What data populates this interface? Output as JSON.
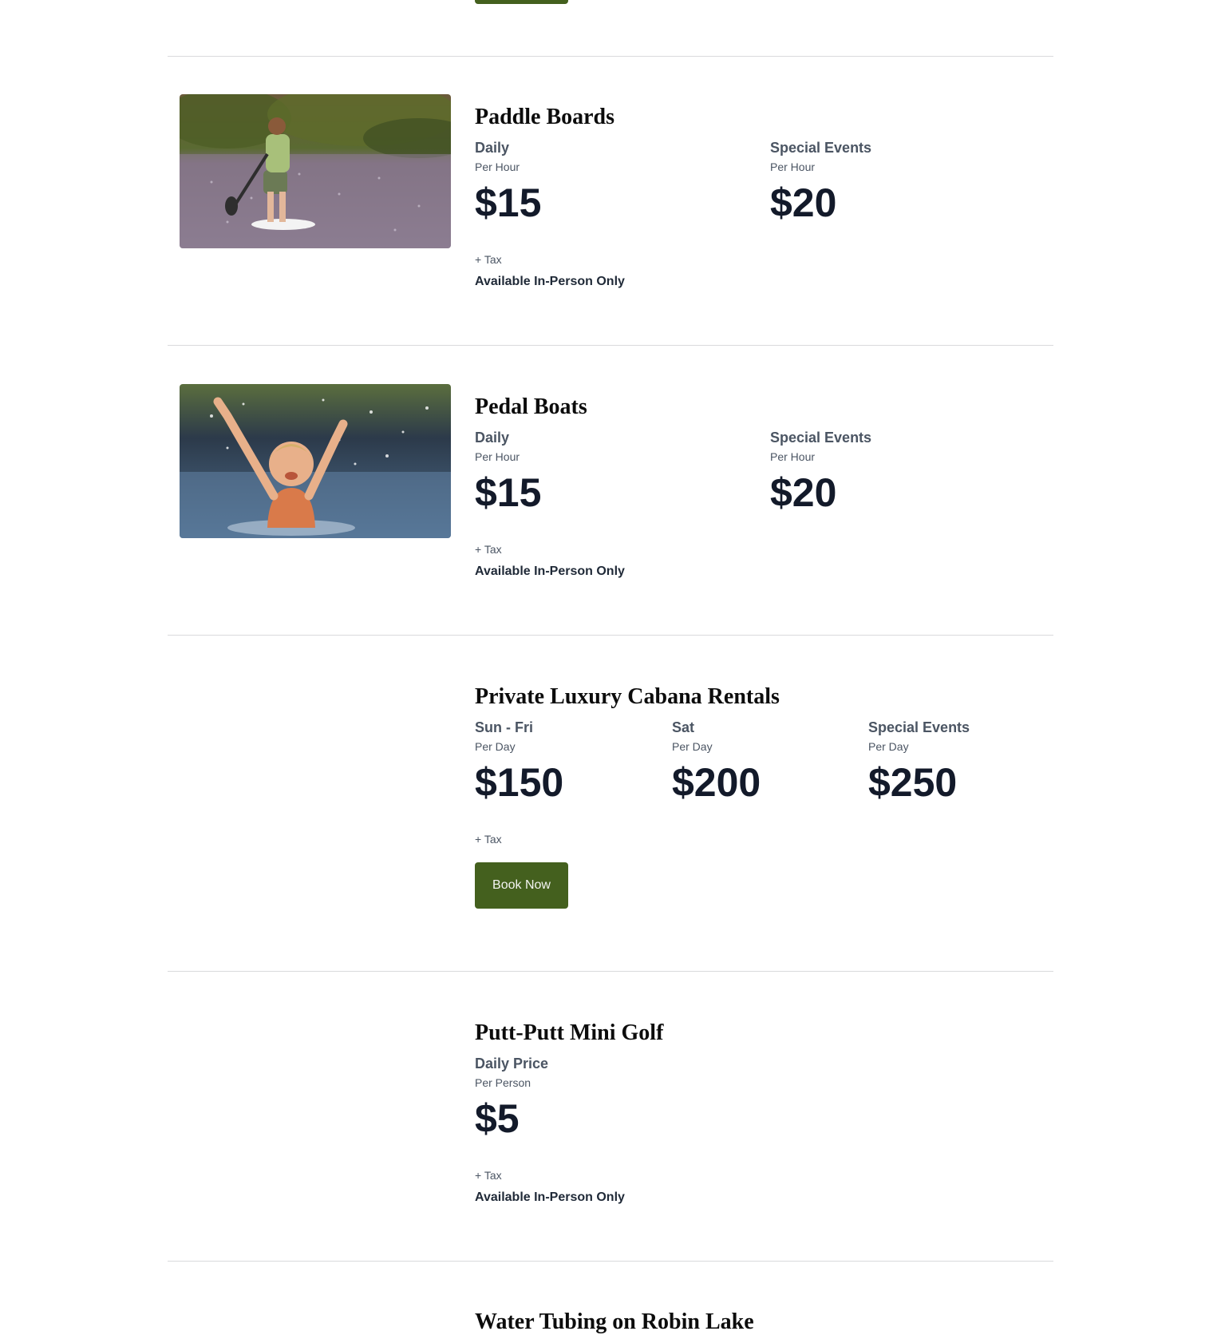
{
  "colors": {
    "accent": "#44601e",
    "price_text": "#131a2a",
    "muted_text": "#4b5563",
    "divider": "#d9dadc"
  },
  "offerings": [
    {
      "title": "Paddle Boards",
      "image": "photo-child-on-paddle-board",
      "tiers": [
        {
          "label": "Daily",
          "unit": "Per Hour",
          "price": "$15"
        },
        {
          "label": "Special Events",
          "unit": "Per Hour",
          "price": "$20"
        }
      ],
      "tax": "+ Tax",
      "note": "Available In-Person Only"
    },
    {
      "title": "Pedal Boats",
      "image": "photo-girl-splashing-in-lake",
      "tiers": [
        {
          "label": "Daily",
          "unit": "Per Hour",
          "price": "$15"
        },
        {
          "label": "Special Events",
          "unit": "Per Hour",
          "price": "$20"
        }
      ],
      "tax": "+ Tax",
      "note": "Available In-Person Only"
    },
    {
      "title": "Private Luxury Cabana Rentals",
      "tiers": [
        {
          "label": "Sun - Fri",
          "unit": "Per Day",
          "price": "$150"
        },
        {
          "label": "Sat",
          "unit": "Per Day",
          "price": "$200"
        },
        {
          "label": "Special Events",
          "unit": "Per Day",
          "price": "$250"
        }
      ],
      "tax": "+ Tax",
      "button": "Book Now"
    },
    {
      "title": "Putt-Putt Mini Golf",
      "tiers": [
        {
          "label": "Daily Price",
          "unit": "Per Person",
          "price": "$5"
        }
      ],
      "tax": "+ Tax",
      "note": "Available In-Person Only"
    },
    {
      "title": "Water Tubing on Robin Lake"
    }
  ]
}
